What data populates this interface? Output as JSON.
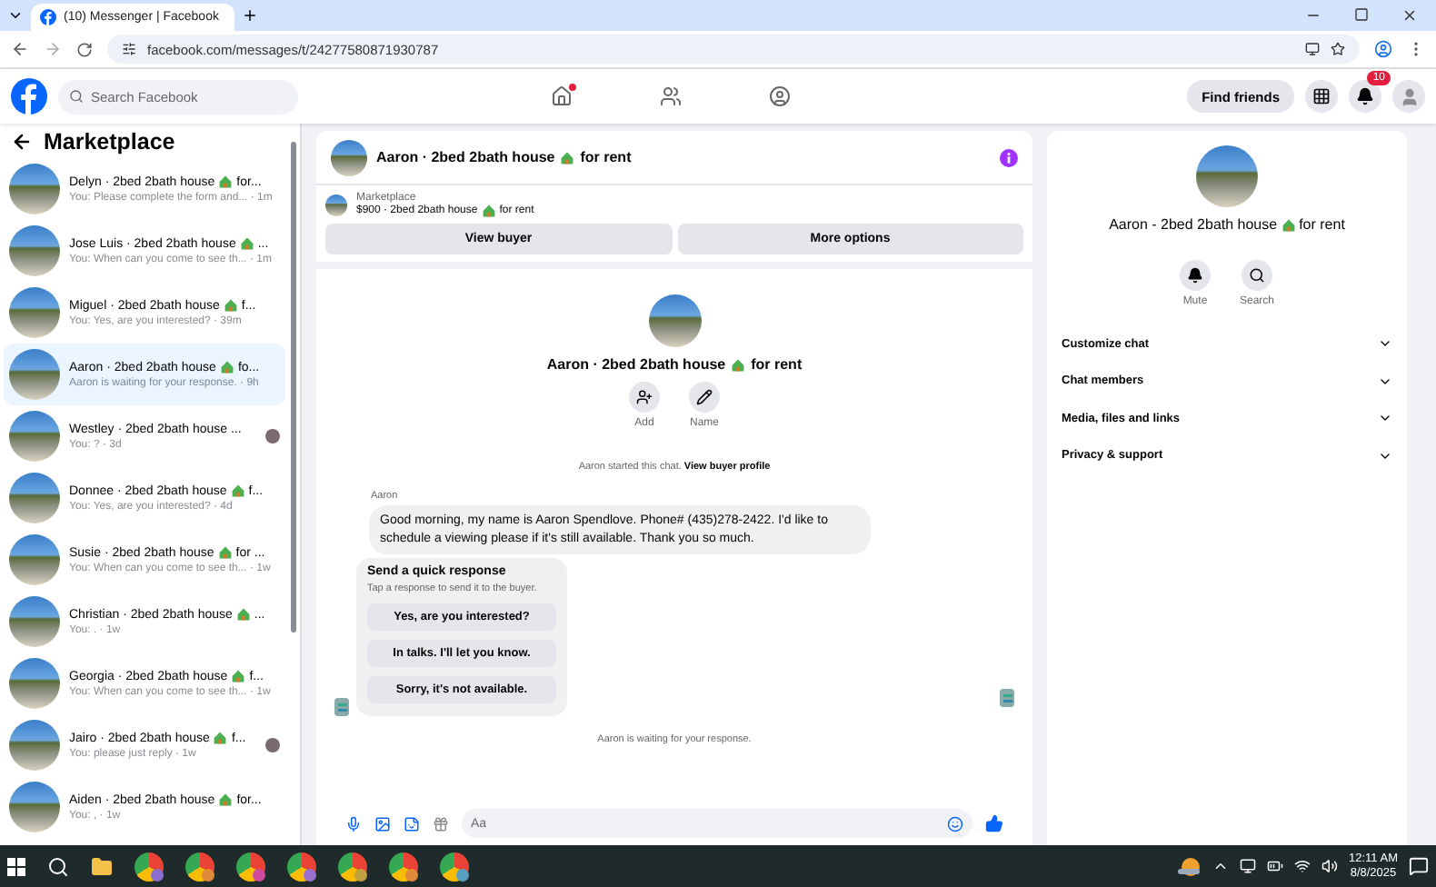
{
  "browser": {
    "tab_title": "(10) Messenger | Facebook",
    "url": "facebook.com/messages/t/24277580871930787"
  },
  "header": {
    "search_placeholder": "Search Facebook",
    "home_dot": true,
    "find_friends": "Find friends",
    "notification_count": "10"
  },
  "sidebar": {
    "title": "Marketplace",
    "conversations": [
      {
        "title": "Delyn · 2bed 2bath house",
        "house": true,
        "title_end": "for...",
        "preview": "You: Please complete the form and... · 1m",
        "selected": false,
        "seen_avatar": false
      },
      {
        "title": "Jose Luis · 2bed 2bath house",
        "house": true,
        "title_end": "...",
        "preview": "You: When can you come to see th... · 1m",
        "selected": false,
        "seen_avatar": false
      },
      {
        "title": "Miguel · 2bed 2bath house",
        "house": true,
        "title_end": "f...",
        "preview": "You: Yes, are you interested? · 39m",
        "selected": false,
        "seen_avatar": false
      },
      {
        "title": "Aaron · 2bed 2bath house",
        "house": true,
        "title_end": "fo...",
        "preview": "Aaron is waiting for your response. · 9h",
        "selected": true,
        "seen_avatar": false
      },
      {
        "title": "Westley · 2bed 2bath house ...",
        "house": false,
        "preview": "You: ? · 3d",
        "selected": false,
        "seen_avatar": true
      },
      {
        "title": "Donnee · 2bed 2bath house",
        "house": true,
        "title_end": "f...",
        "preview": "You: Yes, are you interested? · 4d",
        "selected": false,
        "seen_avatar": false
      },
      {
        "title": "Susie · 2bed 2bath house",
        "house": true,
        "title_end": "for ...",
        "preview": "You: When can you come to see th... · 1w",
        "selected": false,
        "seen_avatar": false
      },
      {
        "title": "Christian · 2bed 2bath house",
        "house": true,
        "title_end": "...",
        "preview": "You: . · 1w",
        "selected": false,
        "seen_avatar": false
      },
      {
        "title": "Georgia · 2bed 2bath house",
        "house": true,
        "title_end": "f...",
        "preview": "You: When can you come to see th... · 1w",
        "selected": false,
        "seen_avatar": false
      },
      {
        "title": "Jairo · 2bed 2bath house",
        "house": true,
        "title_end": "f...",
        "preview": "You: please just reply · 1w",
        "selected": false,
        "seen_avatar": true
      },
      {
        "title": "Aiden · 2bed 2bath house",
        "house": true,
        "title_end": "for...",
        "preview": "You: , · 1w",
        "selected": false,
        "seen_avatar": false
      }
    ]
  },
  "chat": {
    "title": "Aaron · 2bed 2bath house",
    "title_end": "for rent",
    "listing_label": "Marketplace",
    "listing": "$900 · 2bed 2bath house",
    "listing_end": "for rent",
    "buttons": [
      "View buyer",
      "More options"
    ],
    "profile_title": "Aaron · 2bed 2bath house",
    "profile_title_end": "for rent",
    "actions": [
      "Add",
      "Name"
    ],
    "started": "Aaron started this chat.",
    "started_link": "View buyer profile",
    "sender": "Aaron",
    "message": "Good morning, my name is Aaron Spendlove. Phone# (435)278-2422. I'd like to schedule a viewing please if it's still available. Thank you so much.",
    "quick_title": "Send a quick response",
    "quick_hint": "Tap a response to send it to the buyer.",
    "quick_responses": [
      "Yes, are you interested?",
      "In talks. I'll let you know.",
      "Sorry, it's not available."
    ],
    "waiting": "Aaron is waiting for your response.",
    "composer_placeholder": "Aa"
  },
  "details": {
    "title": "Aaron - 2bed 2bath house",
    "title_end": "for rent",
    "actions": [
      "Mute",
      "Search"
    ],
    "sections": [
      "Customize chat",
      "Chat members",
      "Media, files and links",
      "Privacy & support"
    ]
  },
  "taskbar": {
    "time": "12:11 AM",
    "date": "8/8/2025"
  }
}
